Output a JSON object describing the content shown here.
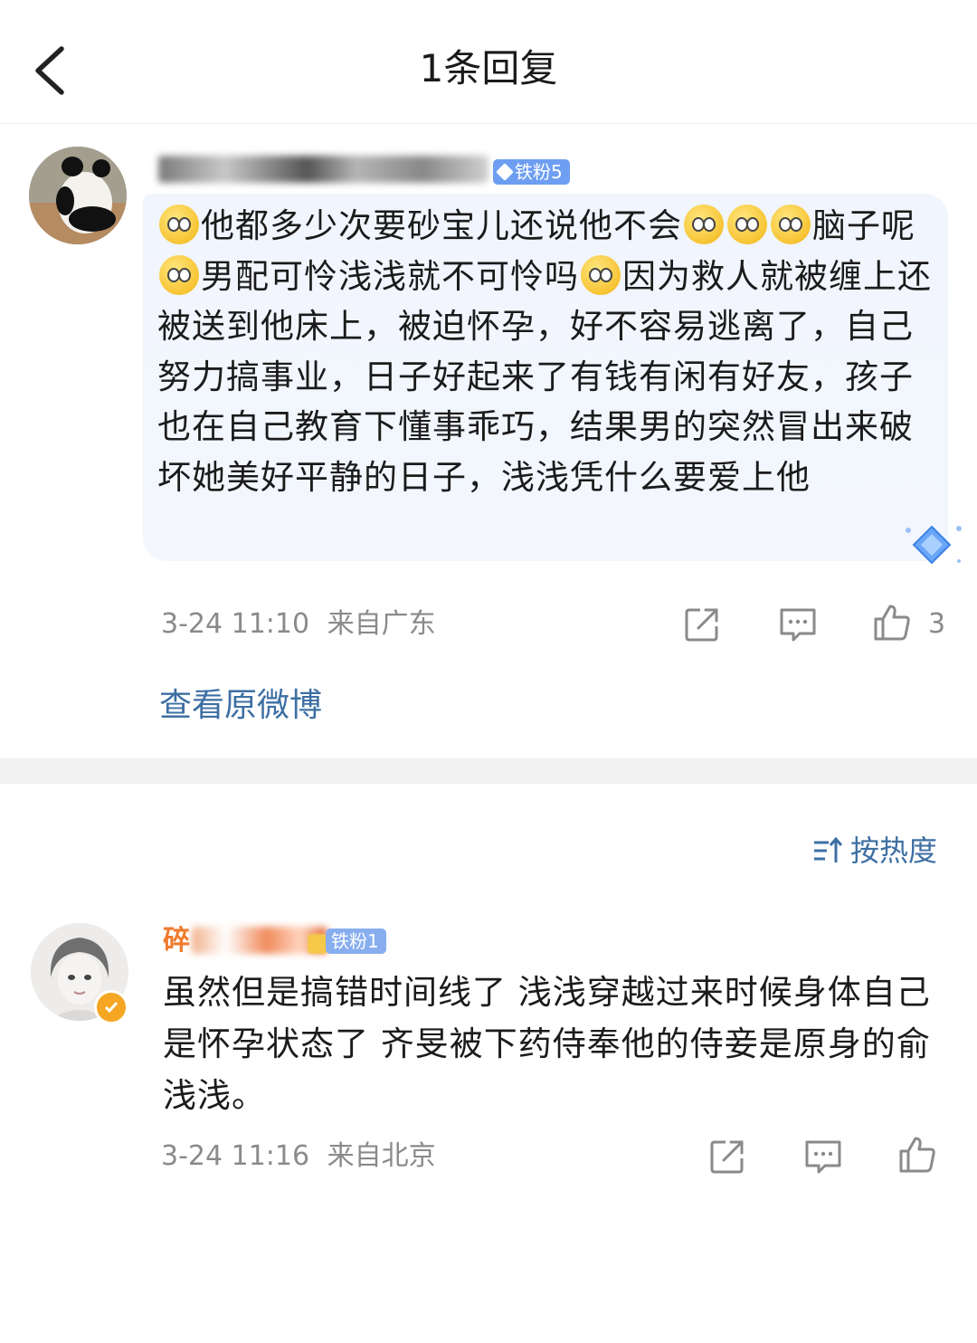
{
  "header": {
    "title": "1条回复",
    "back_label": "返回"
  },
  "main_comment": {
    "badge": "铁粉5",
    "text": "他都多少次要砂宝儿还说他不会",
    "text_parts": [
      {
        "type": "emoji"
      },
      {
        "type": "text",
        "value": "他都多少次要砂宝儿还说他不会"
      },
      {
        "type": "emoji"
      },
      {
        "type": "emoji"
      },
      {
        "type": "emoji"
      },
      {
        "type": "text",
        "value": "脑子呢"
      },
      {
        "type": "emoji"
      },
      {
        "type": "text",
        "value": "男配可怜浅浅就不可怜吗"
      },
      {
        "type": "emoji"
      },
      {
        "type": "text",
        "value": "因为救人就被缠上还被送到他床上，被迫怀孕，好不容易逃离了，自己努力搞事业，日子好起来了有钱有闲有好友，孩子也在自己教育下懂事乖巧，结果男的突然冒出来破坏她美好平静的日子，浅浅凭什么要爱上他"
      }
    ],
    "time": "3-24 11:10",
    "location": "来自广东",
    "like_count": "3",
    "view_original": "查看原微博"
  },
  "sort": {
    "label": "按热度"
  },
  "reply_comment": {
    "name_prefix": "碎",
    "badge": "铁粉1",
    "text": "虽然但是搞错时间线了 浅浅穿越过来时候身体自己是怀孕状态了 齐旻被下药侍奉他的侍妾是原身的俞浅浅。",
    "time": "3-24 11:16",
    "location": "来自北京"
  },
  "colors": {
    "link": "#3d6fa3",
    "badge": "#6d9ef2",
    "meta": "#8a8a8a",
    "bubble": "#f2f5fd"
  }
}
